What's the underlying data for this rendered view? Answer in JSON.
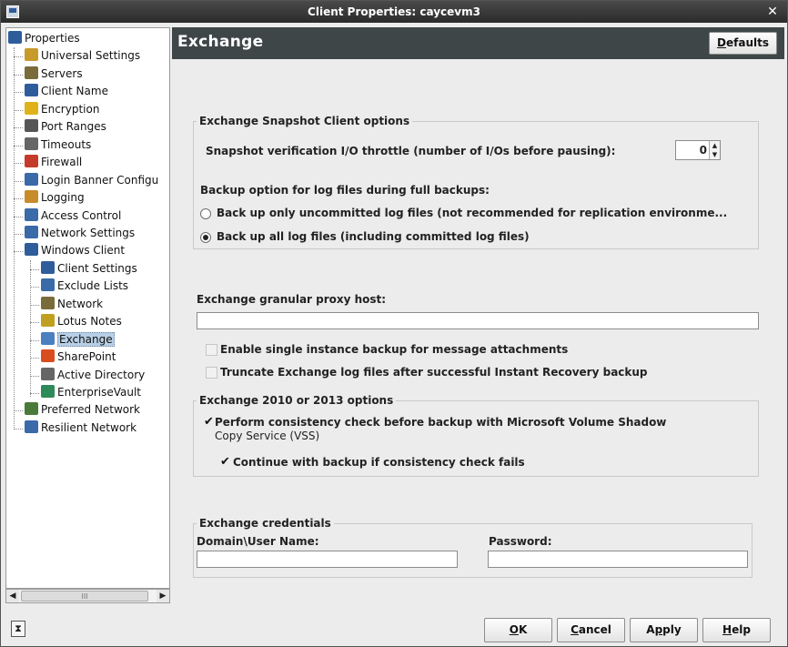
{
  "window": {
    "title": "Client Properties: caycevm3"
  },
  "tree": {
    "items": [
      {
        "label": "Properties",
        "icon": "computer-icon",
        "color": "#2f5d9b"
      },
      {
        "label": "Universal Settings",
        "icon": "settings-globe-icon",
        "color": "#c79a2b"
      },
      {
        "label": "Servers",
        "icon": "server-icon",
        "color": "#7a6b3a"
      },
      {
        "label": "Client Name",
        "icon": "computer-icon",
        "color": "#2f5d9b"
      },
      {
        "label": "Encryption",
        "icon": "lock-icon",
        "color": "#e0b21a"
      },
      {
        "label": "Port Ranges",
        "icon": "port-icon",
        "color": "#555555"
      },
      {
        "label": "Timeouts",
        "icon": "clock-icon",
        "color": "#666666"
      },
      {
        "label": "Firewall",
        "icon": "firewall-icon",
        "color": "#c63a2a"
      },
      {
        "label": "Login Banner Configu",
        "icon": "banner-icon",
        "color": "#3a6aa8"
      },
      {
        "label": "Logging",
        "icon": "log-icon",
        "color": "#c88b2a"
      },
      {
        "label": "Access Control",
        "icon": "access-icon",
        "color": "#3a6aa8"
      },
      {
        "label": "Network Settings",
        "icon": "network-icon",
        "color": "#3a6aa8"
      },
      {
        "label": "Windows Client",
        "icon": "computer-icon",
        "color": "#2f5d9b"
      },
      {
        "label": "Client Settings",
        "icon": "computer-icon",
        "color": "#2f5d9b"
      },
      {
        "label": "Exclude Lists",
        "icon": "exclude-icon",
        "color": "#3a6aa8"
      },
      {
        "label": "Network",
        "icon": "network-plug-icon",
        "color": "#7a6b3a"
      },
      {
        "label": "Lotus Notes",
        "icon": "lotus-icon",
        "color": "#c0a020"
      },
      {
        "label": "Exchange",
        "icon": "exchange-icon",
        "color": "#4a7fc0"
      },
      {
        "label": "SharePoint",
        "icon": "sharepoint-icon",
        "color": "#d94e1f"
      },
      {
        "label": "Active Directory",
        "icon": "directory-icon",
        "color": "#666666"
      },
      {
        "label": "EnterpriseVault",
        "icon": "vault-icon",
        "color": "#2f8a5a"
      },
      {
        "label": "Preferred Network",
        "icon": "preferred-network-icon",
        "color": "#4a7a3a"
      },
      {
        "label": "Resilient Network",
        "icon": "resilient-network-icon",
        "color": "#3a6aa8"
      }
    ]
  },
  "header": {
    "title": "Exchange",
    "defaults_label": "Defaults"
  },
  "snapshot": {
    "group_title": "Exchange Snapshot Client options",
    "throttle_label": "Snapshot verification I/O throttle (number of I/Os before pausing):",
    "throttle_value": "0",
    "log_option_label": "Backup option for log files during full backups:",
    "radio_uncommitted": "Back up only uncommitted log files (not recommended for replication environme...",
    "radio_all": "Back up all log files (including committed log files)"
  },
  "proxy": {
    "label": "Exchange granular proxy host:",
    "value": ""
  },
  "options": {
    "single_instance": "Enable single instance backup for message attachments",
    "truncate": "Truncate Exchange log files after successful Instant Recovery backup"
  },
  "exchange2010": {
    "group_title": "Exchange 2010 or 2013 options",
    "consistency_line1": "Perform consistency check before backup with Microsoft Volume Shadow",
    "consistency_line2": "Copy Service (VSS)",
    "continue_label": "Continue with backup if consistency check fails"
  },
  "credentials": {
    "group_title": "Exchange credentials",
    "username_label": "Domain\\User Name:",
    "password_label": "Password:",
    "username_value": "",
    "password_value": ""
  },
  "footer": {
    "ok": "OK",
    "cancel": "Cancel",
    "apply": "Apply",
    "help": "Help"
  }
}
